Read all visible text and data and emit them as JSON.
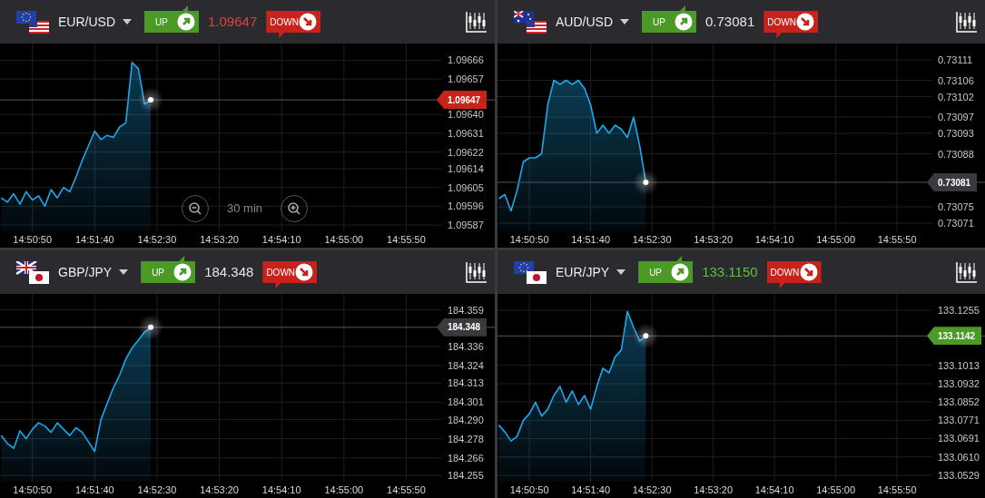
{
  "panels": [
    {
      "pair": "EUR/USD",
      "flags": [
        {
          "kind": "eu"
        },
        {
          "kind": "us"
        }
      ],
      "up_label": "UP",
      "down_label": "DOWN",
      "price": "1.09647",
      "color": "#e0403a",
      "marker": {
        "text": "1.09647",
        "color": "#c7221b"
      },
      "zoom": {
        "label": "30 min"
      },
      "chart_data": {
        "type": "area",
        "grid": true,
        "ref_lines": [
          {
            "axis": "y",
            "value": 1.09647
          }
        ],
        "x": [
          53425,
          53430,
          53435,
          53440,
          53445,
          53450,
          53455,
          53460,
          53465,
          53470,
          53475,
          53480,
          53485,
          53490,
          53495,
          53500,
          53505,
          53510,
          53515,
          53520,
          53525,
          53530,
          53535,
          53540,
          53545
        ],
        "series": [
          {
            "color": "#1ea7ea",
            "values": [
              1.096,
              1.09598,
              1.09602,
              1.09597,
              1.09603,
              1.09599,
              1.09601,
              1.09596,
              1.09604,
              1.096,
              1.09605,
              1.09603,
              1.0961,
              1.09618,
              1.09625,
              1.09632,
              1.09628,
              1.0963,
              1.09629,
              1.09634,
              1.09636,
              1.09665,
              1.09662,
              1.09645,
              1.09647
            ]
          }
        ],
        "xlim": [
          53424,
          53781
        ],
        "ylim": [
          1.09584,
          1.09674
        ],
        "yticks": [
          {
            "value": 1.09666,
            "label": "1.09666"
          },
          {
            "value": 1.09657,
            "label": "1.09657"
          },
          {
            "value": 1.0964,
            "label": "1.09640"
          },
          {
            "value": 1.09631,
            "label": "1.09631"
          },
          {
            "value": 1.09622,
            "label": "1.09622"
          },
          {
            "value": 1.09614,
            "label": "1.09614"
          },
          {
            "value": 1.09605,
            "label": "1.09605"
          },
          {
            "value": 1.09596,
            "label": "1.09596"
          },
          {
            "value": 1.09587,
            "label": "1.09587"
          }
        ],
        "xticks": [
          {
            "value": 53450,
            "label": "14:50:50"
          },
          {
            "value": 53500,
            "label": "14:51:40"
          },
          {
            "value": 53550,
            "label": "14:52:30"
          },
          {
            "value": 53600,
            "label": "14:53:20"
          },
          {
            "value": 53650,
            "label": "14:54:10"
          },
          {
            "value": 53700,
            "label": "14:55:00"
          },
          {
            "value": 53750,
            "label": "14:55:50"
          }
        ]
      }
    },
    {
      "pair": "AUD/USD",
      "flags": [
        {
          "kind": "au"
        },
        {
          "kind": "us"
        }
      ],
      "up_label": "UP",
      "down_label": "DOWN",
      "price": "0.73081",
      "color": "#e6e6e6",
      "marker": {
        "text": "0.73081",
        "color": "#3a3a3e"
      },
      "chart_data": {
        "type": "area",
        "grid": true,
        "ref_lines": [
          {
            "axis": "y",
            "value": 0.73081
          }
        ],
        "x": [
          53425,
          53430,
          53435,
          53440,
          53445,
          53450,
          53455,
          53460,
          53465,
          53470,
          53475,
          53480,
          53485,
          53490,
          53495,
          53500,
          53505,
          53510,
          53515,
          53520,
          53525,
          53530,
          53535,
          53540,
          53545
        ],
        "series": [
          {
            "color": "#1ea7ea",
            "values": [
              0.73077,
              0.73078,
              0.73074,
              0.73079,
              0.73086,
              0.73087,
              0.73087,
              0.73088,
              0.731,
              0.73106,
              0.73105,
              0.73106,
              0.73105,
              0.73106,
              0.73104,
              0.731,
              0.73093,
              0.73095,
              0.73093,
              0.73095,
              0.73094,
              0.73092,
              0.73097,
              0.7309,
              0.73081
            ]
          }
        ],
        "xlim": [
          53424,
          53781
        ],
        "ylim": [
          0.73069,
          0.73115
        ],
        "yticks": [
          {
            "value": 0.73111,
            "label": "0.73111"
          },
          {
            "value": 0.73106,
            "label": "0.73106"
          },
          {
            "value": 0.73102,
            "label": "0.73102"
          },
          {
            "value": 0.73097,
            "label": "0.73097"
          },
          {
            "value": 0.73093,
            "label": "0.73093"
          },
          {
            "value": 0.73088,
            "label": "0.73088"
          },
          {
            "value": 0.73075,
            "label": "0.73075"
          },
          {
            "value": 0.73071,
            "label": "0.73071"
          }
        ],
        "xticks": [
          {
            "value": 53450,
            "label": "14:50:50"
          },
          {
            "value": 53500,
            "label": "14:51:40"
          },
          {
            "value": 53550,
            "label": "14:52:30"
          },
          {
            "value": 53600,
            "label": "14:53:20"
          },
          {
            "value": 53650,
            "label": "14:54:10"
          },
          {
            "value": 53700,
            "label": "14:55:00"
          },
          {
            "value": 53750,
            "label": "14:55:50"
          }
        ]
      }
    },
    {
      "pair": "GBP/JPY",
      "flags": [
        {
          "kind": "gb"
        },
        {
          "kind": "jp"
        }
      ],
      "up_label": "UP",
      "down_label": "DOWN",
      "price": "184.348",
      "color": "#e6e6e6",
      "marker": {
        "text": "184.348",
        "color": "#3a3a3e"
      },
      "chart_data": {
        "type": "area",
        "grid": true,
        "ref_lines": [
          {
            "axis": "y",
            "value": 184.348
          }
        ],
        "x": [
          53425,
          53430,
          53435,
          53440,
          53445,
          53450,
          53455,
          53460,
          53465,
          53470,
          53475,
          53480,
          53485,
          53490,
          53495,
          53500,
          53505,
          53510,
          53515,
          53520,
          53525,
          53530,
          53535,
          53540,
          53545
        ],
        "series": [
          {
            "color": "#1ea7ea",
            "values": [
              184.28,
              184.275,
              184.272,
              184.283,
              184.278,
              184.284,
              184.288,
              184.286,
              184.282,
              184.288,
              184.284,
              184.28,
              184.285,
              184.282,
              184.276,
              184.27,
              184.29,
              184.3,
              184.31,
              184.318,
              184.328,
              184.335,
              184.34,
              184.345,
              184.348
            ]
          }
        ],
        "xlim": [
          53424,
          53781
        ],
        "ylim": [
          184.251,
          184.369
        ],
        "yticks": [
          {
            "value": 184.359,
            "label": "184.359"
          },
          {
            "value": 184.336,
            "label": "184.336"
          },
          {
            "value": 184.324,
            "label": "184.324"
          },
          {
            "value": 184.313,
            "label": "184.313"
          },
          {
            "value": 184.301,
            "label": "184.301"
          },
          {
            "value": 184.29,
            "label": "184.290"
          },
          {
            "value": 184.278,
            "label": "184.278"
          },
          {
            "value": 184.266,
            "label": "184.266"
          },
          {
            "value": 184.255,
            "label": "184.255"
          }
        ],
        "xticks": [
          {
            "value": 53450,
            "label": "14:50:50"
          },
          {
            "value": 53500,
            "label": "14:51:40"
          },
          {
            "value": 53550,
            "label": "14:52:30"
          },
          {
            "value": 53600,
            "label": "14:53:20"
          },
          {
            "value": 53650,
            "label": "14:54:10"
          },
          {
            "value": 53700,
            "label": "14:55:00"
          },
          {
            "value": 53750,
            "label": "14:55:50"
          }
        ]
      }
    },
    {
      "pair": "EUR/JPY",
      "flags": [
        {
          "kind": "eu"
        },
        {
          "kind": "jp"
        }
      ],
      "up_label": "UP",
      "down_label": "DOWN",
      "price": "133.1150",
      "color": "#5cc23a",
      "marker": {
        "text": "133.1142",
        "color": "#4a9a25"
      },
      "chart_data": {
        "type": "area",
        "grid": true,
        "ref_lines": [
          {
            "axis": "y",
            "value": 133.1142
          }
        ],
        "x": [
          53425,
          53430,
          53435,
          53440,
          53445,
          53450,
          53455,
          53460,
          53465,
          53470,
          53475,
          53480,
          53485,
          53490,
          53495,
          53500,
          53505,
          53510,
          53515,
          53520,
          53525,
          53530,
          53535,
          53540,
          53545
        ],
        "series": [
          {
            "color": "#1ea7ea",
            "values": [
              133.075,
              133.072,
              133.068,
              133.07,
              133.077,
              133.08,
              133.085,
              133.079,
              133.082,
              133.088,
              133.092,
              133.085,
              133.09,
              133.084,
              133.088,
              133.082,
              133.092,
              133.1,
              133.098,
              133.105,
              133.108,
              133.125,
              133.118,
              133.112,
              133.1142
            ]
          }
        ],
        "xlim": [
          53424,
          53781
        ],
        "ylim": [
          133.0501,
          133.1327
        ],
        "yticks": [
          {
            "value": 133.1255,
            "label": "133.1255"
          },
          {
            "value": 133.1013,
            "label": "133.1013"
          },
          {
            "value": 133.0932,
            "label": "133.0932"
          },
          {
            "value": 133.0852,
            "label": "133.0852"
          },
          {
            "value": 133.0771,
            "label": "133.0771"
          },
          {
            "value": 133.0691,
            "label": "133.0691"
          },
          {
            "value": 133.061,
            "label": "133.0610"
          },
          {
            "value": 133.0529,
            "label": "133.0529"
          }
        ],
        "xticks": [
          {
            "value": 53450,
            "label": "14:50:50"
          },
          {
            "value": 53500,
            "label": "14:51:40"
          },
          {
            "value": 53550,
            "label": "14:52:30"
          },
          {
            "value": 53600,
            "label": "14:53:20"
          },
          {
            "value": 53650,
            "label": "14:54:10"
          },
          {
            "value": 53700,
            "label": "14:55:00"
          },
          {
            "value": 53750,
            "label": "14:55:50"
          }
        ]
      }
    }
  ]
}
